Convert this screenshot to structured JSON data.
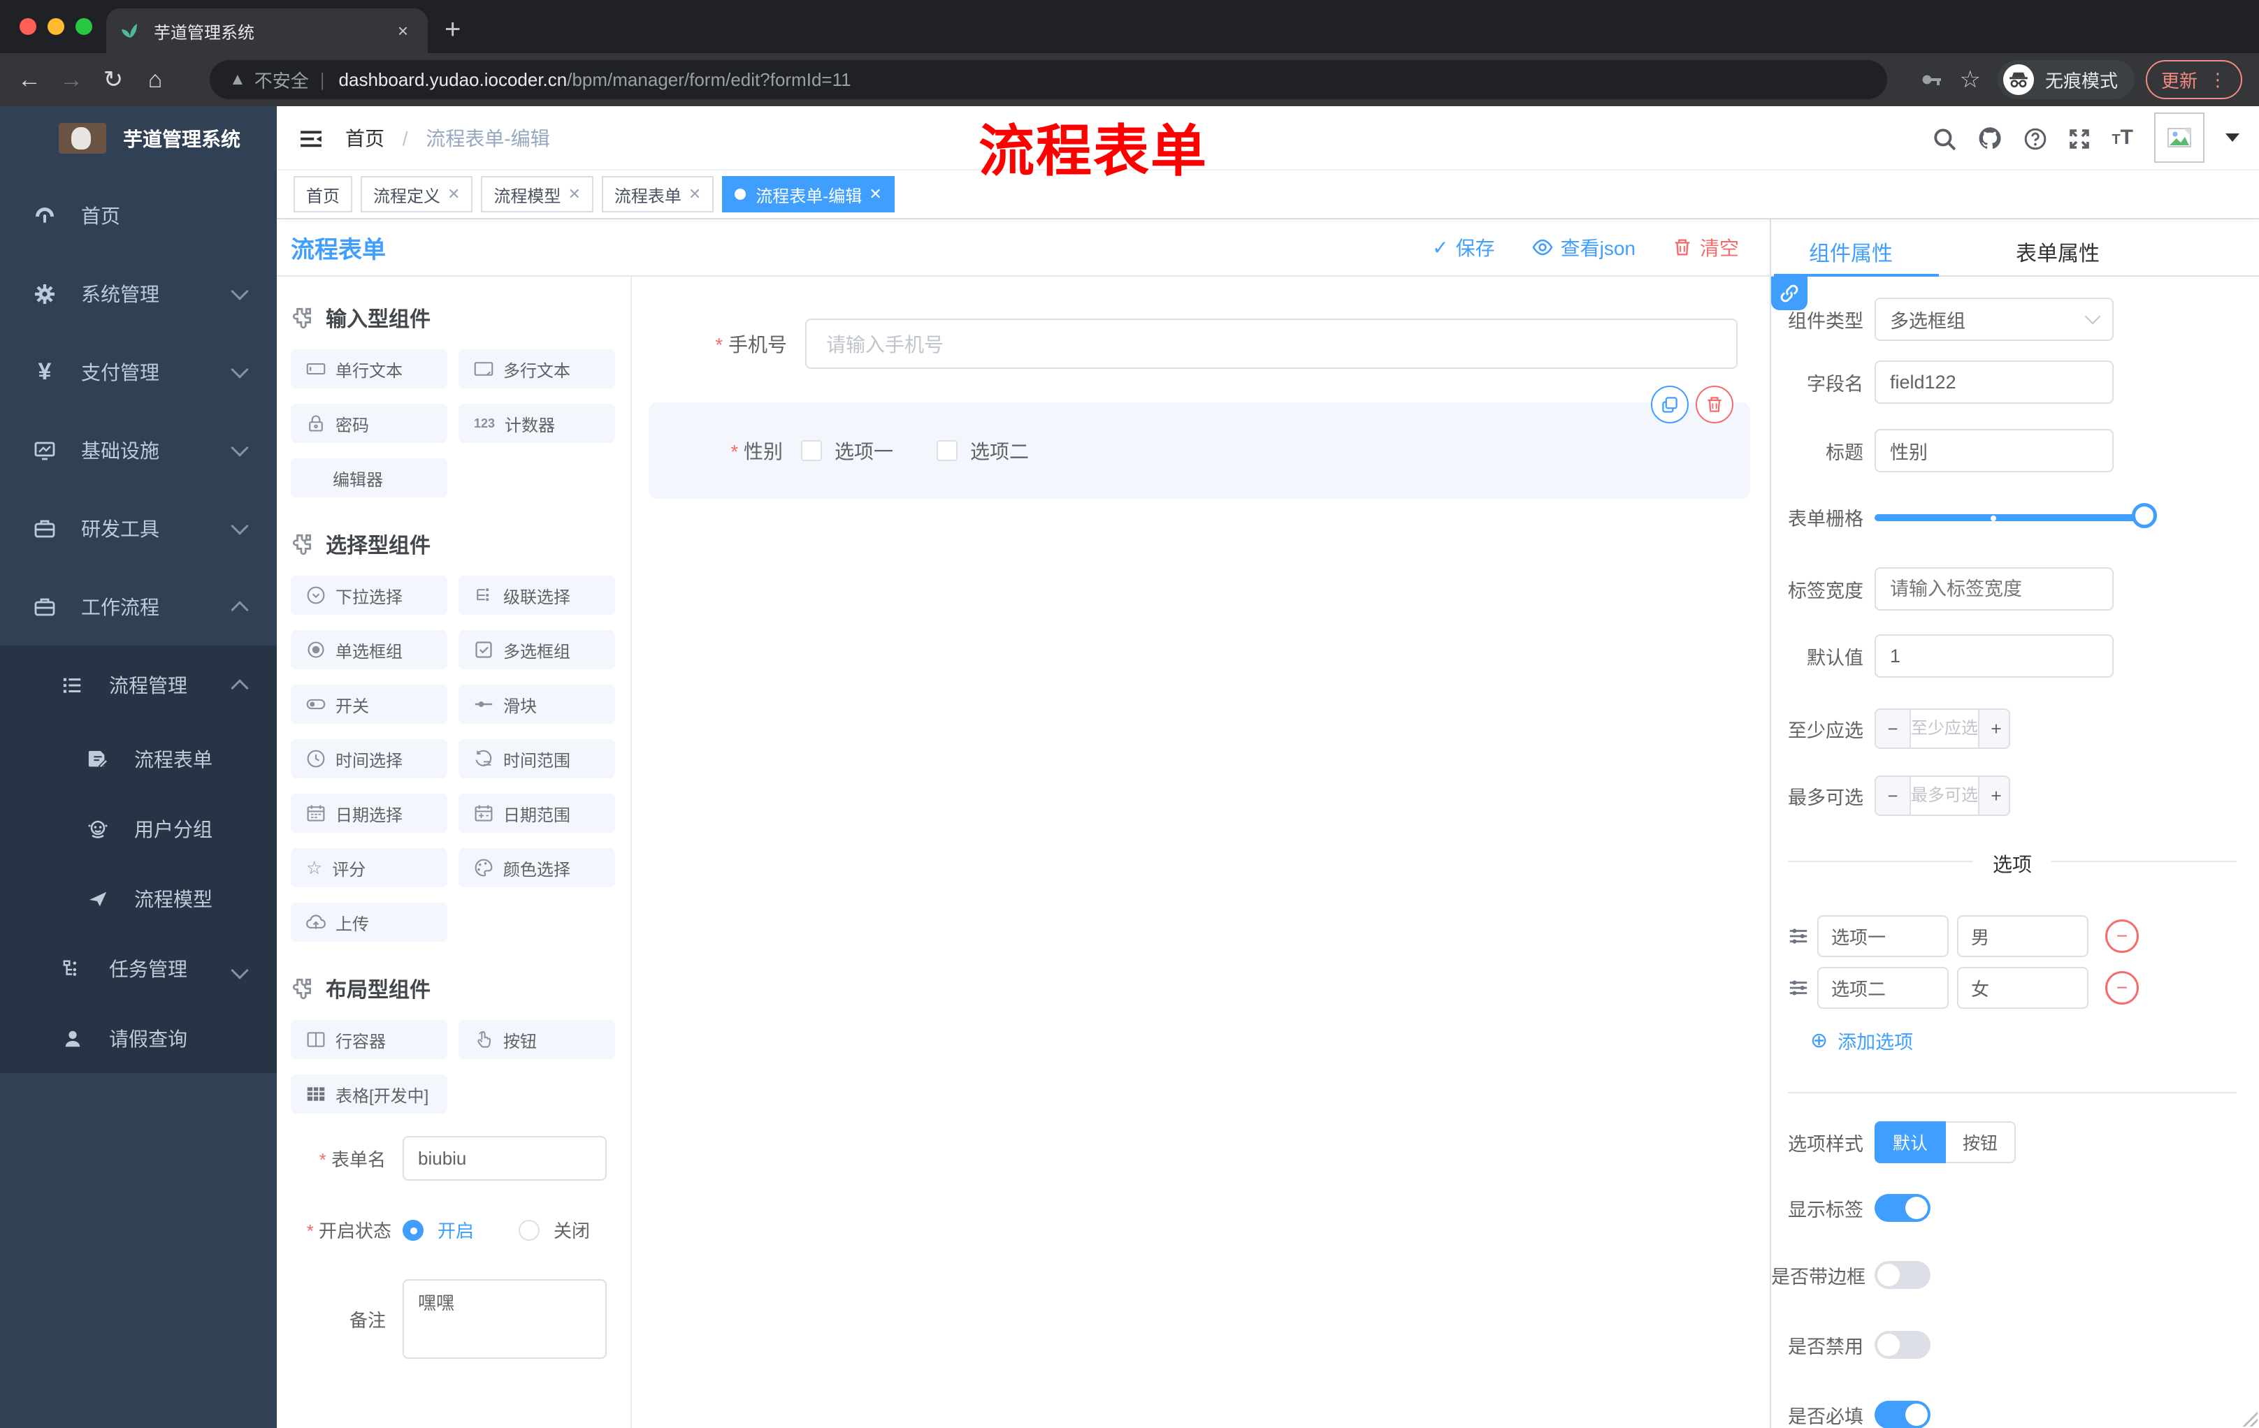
{
  "browser": {
    "tab_title": "芋道管理系统",
    "new_tab": "+",
    "close": "×",
    "back": "←",
    "forward": "→",
    "reload": "↻",
    "home": "⌂",
    "security_label": "不安全",
    "url_domain": "dashboard.yudao.iocoder.cn",
    "url_path": "/bpm/manager/form/edit?formId=11",
    "incognito_label": "无痕模式",
    "update_label": "更新",
    "more": "⋮"
  },
  "sidebar": {
    "app_title": "芋道管理系统",
    "items": [
      {
        "label": "首页",
        "chevron": "none"
      },
      {
        "label": "系统管理",
        "chevron": "down"
      },
      {
        "label": "支付管理",
        "chevron": "down"
      },
      {
        "label": "基础设施",
        "chevron": "down"
      },
      {
        "label": "研发工具",
        "chevron": "down"
      },
      {
        "label": "工作流程",
        "chevron": "up"
      }
    ],
    "submenu": [
      {
        "label": "流程管理",
        "chevron": "up"
      },
      {
        "label": "流程表单"
      },
      {
        "label": "用户分组"
      },
      {
        "label": "流程模型"
      },
      {
        "label": "任务管理",
        "chevron": "down"
      },
      {
        "label": "请假查询"
      }
    ],
    "pay_icon_glyph": "¥"
  },
  "header": {
    "breadcrumb_home": "首页",
    "breadcrumb_sep": "/",
    "breadcrumb_current": "流程表单-编辑"
  },
  "annotation": "流程表单",
  "tags": [
    {
      "label": "首页",
      "closable": false,
      "active": false
    },
    {
      "label": "流程定义",
      "closable": true,
      "active": false
    },
    {
      "label": "流程模型",
      "closable": true,
      "active": false
    },
    {
      "label": "流程表单",
      "closable": true,
      "active": false
    },
    {
      "label": "流程表单-编辑",
      "closable": true,
      "active": true
    }
  ],
  "designer": {
    "title": "流程表单",
    "save_label": "保存",
    "save_check": "✓",
    "view_json_label": "查看json",
    "clear_label": "清空"
  },
  "components": {
    "sections": [
      {
        "title": "输入型组件",
        "items": [
          {
            "label": "单行文本"
          },
          {
            "label": "多行文本"
          },
          {
            "label": "密码"
          },
          {
            "label": "计数器"
          },
          {
            "label": "编辑器"
          }
        ]
      },
      {
        "title": "选择型组件",
        "items": [
          {
            "label": "下拉选择"
          },
          {
            "label": "级联选择"
          },
          {
            "label": "单选框组"
          },
          {
            "label": "多选框组"
          },
          {
            "label": "开关"
          },
          {
            "label": "滑块"
          },
          {
            "label": "时间选择"
          },
          {
            "label": "时间范围"
          },
          {
            "label": "日期选择"
          },
          {
            "label": "日期范围"
          },
          {
            "label": "评分"
          },
          {
            "label": "颜色选择"
          },
          {
            "label": "上传"
          }
        ]
      },
      {
        "title": "布局型组件",
        "items": [
          {
            "label": "行容器"
          },
          {
            "label": "按钮"
          },
          {
            "label": "表格[开发中]"
          }
        ]
      }
    ],
    "counter_icon_text": "123"
  },
  "form_config": {
    "name_label": "表单名",
    "name_value": "biubiu",
    "status_label": "开启状态",
    "status_on": "开启",
    "status_off": "关闭",
    "status_selected": "开启",
    "remark_label": "备注",
    "remark_value": "嘿嘿"
  },
  "canvas": {
    "phone_label": "手机号",
    "phone_placeholder": "请输入手机号",
    "gender_label": "性别",
    "gender_option1": "选项一",
    "gender_option2": "选项二"
  },
  "properties": {
    "tab_component": "组件属性",
    "tab_form": "表单属性",
    "type_label": "组件类型",
    "type_value": "多选框组",
    "field_label": "字段名",
    "field_value": "field122",
    "title_label": "标题",
    "title_value": "性别",
    "grid_label": "表单栅格",
    "width_label": "标签宽度",
    "width_placeholder": "请输入标签宽度",
    "default_label": "默认值",
    "default_value": "1",
    "min_label": "至少应选",
    "min_placeholder": "至少应选",
    "max_label": "最多可选",
    "max_placeholder": "最多可选",
    "stepper_minus": "−",
    "stepper_plus": "+",
    "options_divider": "选项",
    "options": [
      {
        "label": "选项一",
        "value": "男"
      },
      {
        "label": "选项二",
        "value": "女"
      }
    ],
    "remove_glyph": "−",
    "add_option_label": "添加选项",
    "add_glyph": "⊕",
    "style_label": "选项样式",
    "style_default": "默认",
    "style_button": "按钮",
    "style_selected": "默认",
    "switches": [
      {
        "label": "显示标签",
        "on": true
      },
      {
        "label": "是否带边框",
        "on": false
      },
      {
        "label": "是否禁用",
        "on": false
      },
      {
        "label": "是否必填",
        "on": true
      }
    ]
  },
  "colors": {
    "accent": "#409eff",
    "danger": "#f56c6c",
    "sidebar_bg": "#304156",
    "submenu_bg": "#263445",
    "active_tag": "#409eff",
    "annotation": "#fe0000"
  }
}
